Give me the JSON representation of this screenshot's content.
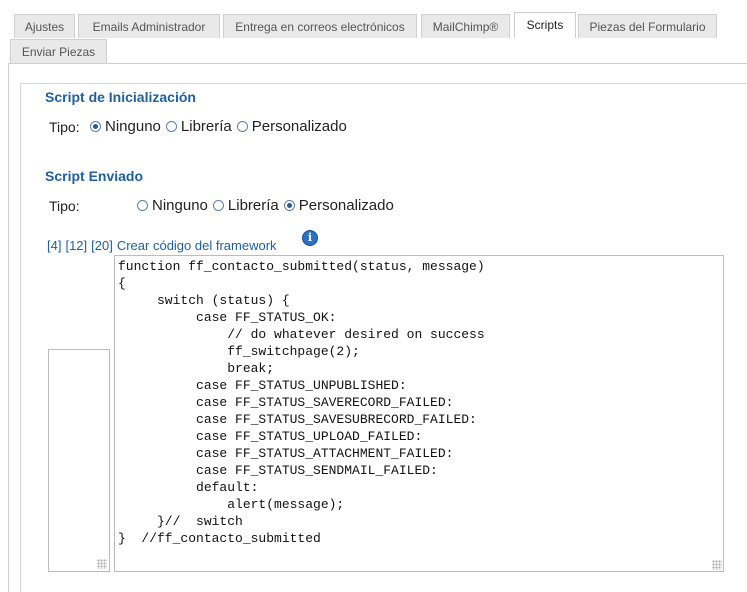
{
  "tabs": [
    {
      "label": "Ajustes",
      "active": false
    },
    {
      "label": "Emails Administrador",
      "active": false
    },
    {
      "label": "Entrega en correos electrónicos",
      "active": false
    },
    {
      "label": "MailChimp®",
      "active": false
    },
    {
      "label": "Scripts",
      "active": true
    },
    {
      "label": "Piezas del Formulario",
      "active": false
    },
    {
      "label": "Enviar Piezas",
      "active": false
    }
  ],
  "init_script": {
    "title": "Script de Inicialización",
    "tipo_label": "Tipo:",
    "options": [
      "Ninguno",
      "Librería",
      "Personalizado"
    ],
    "selected": "Ninguno"
  },
  "submit_script": {
    "title": "Script Enviado",
    "tipo_label": "Tipo:",
    "options": [
      "Ninguno",
      "Librería",
      "Personalizado"
    ],
    "selected": "Personalizado"
  },
  "links": {
    "l4": "[4]",
    "l12": "[12]",
    "l20": "[20]",
    "framework": "Crear código del framework"
  },
  "icons": {
    "info": "info-icon"
  },
  "code": "function ff_contacto_submitted(status, message)\n{\n     switch (status) {\n          case FF_STATUS_OK:\n              // do whatever desired on success\n              ff_switchpage(2);\n              break;\n          case FF_STATUS_UNPUBLISHED:\n          case FF_STATUS_SAVERECORD_FAILED:\n          case FF_STATUS_SAVESUBRECORD_FAILED:\n          case FF_STATUS_UPLOAD_FAILED:\n          case FF_STATUS_ATTACHMENT_FAILED:\n          case FF_STATUS_SENDMAIL_FAILED:\n          default:\n              alert(message);\n     }//  switch\n}  //ff_contacto_submitted"
}
